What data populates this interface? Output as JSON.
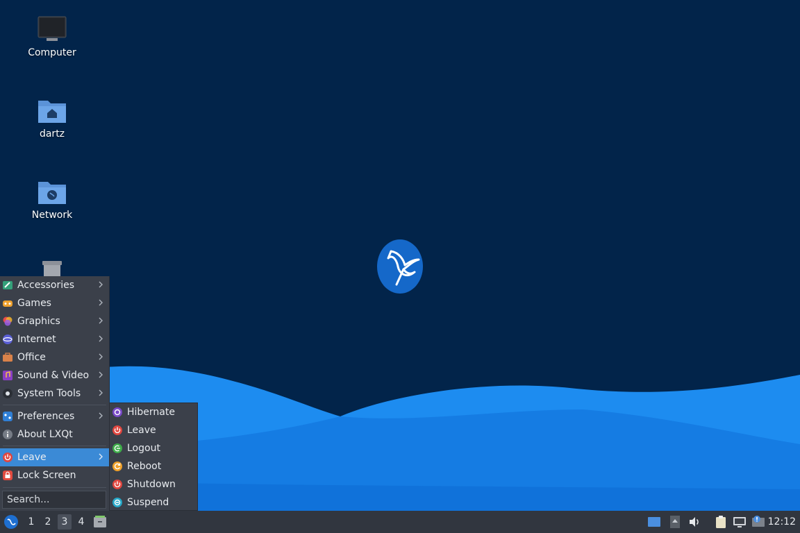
{
  "desktop": {
    "icons": [
      {
        "label": "Computer",
        "icon": "computer-icon"
      },
      {
        "label": "dartz",
        "icon": "home-folder-icon"
      },
      {
        "label": "Network",
        "icon": "network-folder-icon"
      },
      {
        "label": "",
        "icon": "trash-icon"
      }
    ],
    "colors": {
      "background": "#02244a",
      "wave_light": "#1e8ff0",
      "wave_dark": "#0a5cc4"
    }
  },
  "start_menu": {
    "items": [
      {
        "label": "Accessories",
        "icon": "accessories-icon",
        "submenu": true
      },
      {
        "label": "Games",
        "icon": "games-icon",
        "submenu": true
      },
      {
        "label": "Graphics",
        "icon": "graphics-icon",
        "submenu": true
      },
      {
        "label": "Internet",
        "icon": "internet-icon",
        "submenu": true
      },
      {
        "label": "Office",
        "icon": "office-icon",
        "submenu": true
      },
      {
        "label": "Sound & Video",
        "icon": "sound-video-icon",
        "submenu": true
      },
      {
        "label": "System Tools",
        "icon": "system-tools-icon",
        "submenu": true
      },
      {
        "label": "Preferences",
        "icon": "preferences-icon",
        "submenu": true
      },
      {
        "label": "About LXQt",
        "icon": "info-icon",
        "submenu": false
      },
      {
        "label": "Leave",
        "icon": "power-icon",
        "submenu": true,
        "active": true
      },
      {
        "label": "Lock Screen",
        "icon": "lock-icon",
        "submenu": false
      }
    ],
    "search": {
      "placeholder": "Search..."
    },
    "accent": "#3b8ad6"
  },
  "leave_submenu": {
    "items": [
      {
        "label": "Hibernate",
        "icon": "hibernate-icon"
      },
      {
        "label": "Leave",
        "icon": "power-icon"
      },
      {
        "label": "Logout",
        "icon": "logout-icon"
      },
      {
        "label": "Reboot",
        "icon": "reboot-icon"
      },
      {
        "label": "Shutdown",
        "icon": "shutdown-icon"
      },
      {
        "label": "Suspend",
        "icon": "suspend-icon"
      }
    ]
  },
  "taskbar": {
    "workspaces": [
      "1",
      "2",
      "3",
      "4"
    ],
    "current_workspace": "3",
    "tray_icons": [
      "show-desktop-icon",
      "tray-expand-icon",
      "volume-icon",
      "clipboard-icon",
      "network-icon",
      "notification-icon"
    ],
    "clock": "12:12"
  }
}
